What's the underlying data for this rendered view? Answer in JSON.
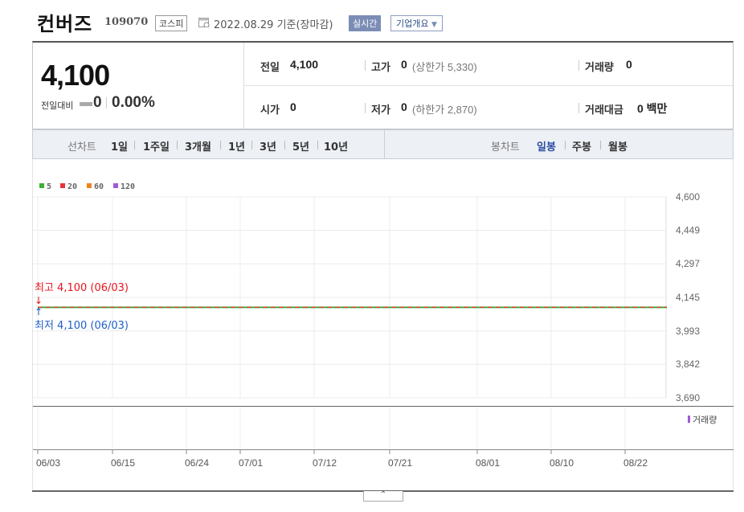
{
  "header": {
    "title": "컨버즈",
    "code": "109070",
    "market": "코스피",
    "date": "2022.08.29 기준(장마감)",
    "realtime": "실시간",
    "overview": "기업개요"
  },
  "summary": {
    "price": "4,100",
    "change_label": "전일대비",
    "change_value": "0",
    "change_pct": "0.00%",
    "prev_close_label": "전일",
    "prev_close": "4,100",
    "high_label": "고가",
    "high": "0",
    "upper_limit": "(상한가 5,330)",
    "volume_label": "거래량",
    "volume": "0",
    "open_label": "시가",
    "open": "0",
    "low_label": "저가",
    "low": "0",
    "lower_limit": "(하한가 2,870)",
    "amount_label": "거래대금",
    "amount": "0 백만"
  },
  "period_bar": {
    "line_label": "선차트",
    "line_periods": [
      "1일",
      "1주일",
      "3개월",
      "1년",
      "3년",
      "5년",
      "10년"
    ],
    "candle_label": "봉차트",
    "candle_periods": [
      "일봉",
      "주봉",
      "월봉"
    ],
    "active_candle": "일봉"
  },
  "colors": {
    "ma5": "#3cb034",
    "ma20": "#e8333c",
    "ma60": "#f0821e",
    "ma120": "#a05ad2",
    "high_text": "#e8121c",
    "low_text": "#1f5fc8"
  },
  "chart_data": {
    "type": "line",
    "legend": [
      {
        "name": "5",
        "color": "#3cb034"
      },
      {
        "name": "20",
        "color": "#e8333c"
      },
      {
        "name": "60",
        "color": "#f0821e"
      },
      {
        "name": "120",
        "color": "#a05ad2"
      }
    ],
    "y_ticks": [
      4600,
      4449,
      4297,
      4145,
      3993,
      3842,
      3690
    ],
    "y_tick_labels": [
      "4,600",
      "4,449",
      "4,297",
      "4,145",
      "3,993",
      "3,842",
      "3,690"
    ],
    "ylim": [
      3690,
      4600
    ],
    "x_tick_labels": [
      "06/03",
      "06/15",
      "06/24",
      "07/01",
      "07/12",
      "07/21",
      "08/01",
      "08/10",
      "08/22"
    ],
    "series": [
      {
        "values_constant": 4100,
        "from": "06/03",
        "to": "08/29"
      }
    ],
    "high_annotation": "최고 4,100 (06/03)",
    "low_annotation": "최저 4,100 (06/03)",
    "volume_label": "거래량"
  }
}
